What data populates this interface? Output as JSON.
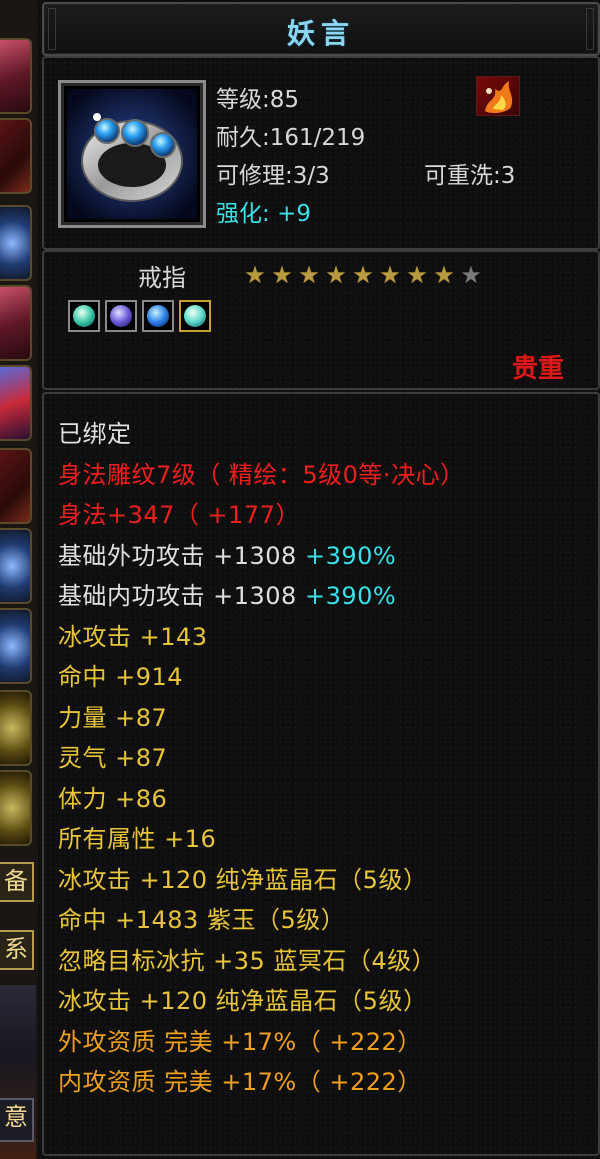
{
  "colors": {
    "title": "#8ad8f0",
    "bonus_cyan": "#3ae0e8",
    "red": "#f01e1e",
    "yellow": "#e8c43a",
    "orange": "#f0a020",
    "white": "#e0e0e0",
    "star_on": "#b89a40",
    "star_off": "#7a7a7a"
  },
  "sidebar": {
    "tab_labels": [
      "备",
      "系",
      "意"
    ]
  },
  "tooltip": {
    "title": "妖言",
    "item_icon": "ring-icon",
    "level": "等级:85",
    "durability": "耐久:161/219",
    "repair": "可修理:3/3",
    "rewash": "可重洗:3",
    "enhance_label": "强化:",
    "enhance_value": "+9",
    "corner_icon": "flame-icon",
    "item_type": "戒指",
    "stars_total": 9,
    "stars_filled": 8,
    "sockets": [
      {
        "icon": "green-gem-icon"
      },
      {
        "icon": "purple-gem-icon"
      },
      {
        "icon": "blue-gem-icon"
      },
      {
        "icon": "green-gem-icon"
      }
    ],
    "rarity": "贵重"
  },
  "attributes": [
    {
      "text": "已绑定",
      "color": "white"
    },
    {
      "text": "身法雕纹7级（ 精绘：5级0等·决心）",
      "color": "red"
    },
    {
      "text": "身法+347（ +177）",
      "color": "red"
    },
    {
      "text": "基础外功攻击  +1308",
      "extra": "+390%",
      "color": "white"
    },
    {
      "text": "基础内功攻击  +1308",
      "extra": "+390%",
      "color": "white"
    },
    {
      "text": "冰攻击  +143",
      "color": "yellow"
    },
    {
      "text": "命中  +914",
      "color": "yellow"
    },
    {
      "text": "力量  +87",
      "color": "yellow"
    },
    {
      "text": "灵气  +87",
      "color": "yellow"
    },
    {
      "text": "体力  +86",
      "color": "yellow"
    },
    {
      "text": "所有属性  +16",
      "color": "yellow"
    },
    {
      "text": "冰攻击  +120  纯净蓝晶石（5级）",
      "color": "yellow"
    },
    {
      "text": "命中  +1483  紫玉（5级）",
      "color": "yellow"
    },
    {
      "text": "忽略目标冰抗  +35  蓝冥石（4级）",
      "color": "yellow"
    },
    {
      "text": "冰攻击  +120  纯净蓝晶石（5级）",
      "color": "yellow"
    },
    {
      "text": "外攻资质    完美  +17%（ +222）",
      "color": "orange"
    },
    {
      "text": "内攻资质    完美  +17%（ +222）",
      "color": "orange"
    }
  ]
}
